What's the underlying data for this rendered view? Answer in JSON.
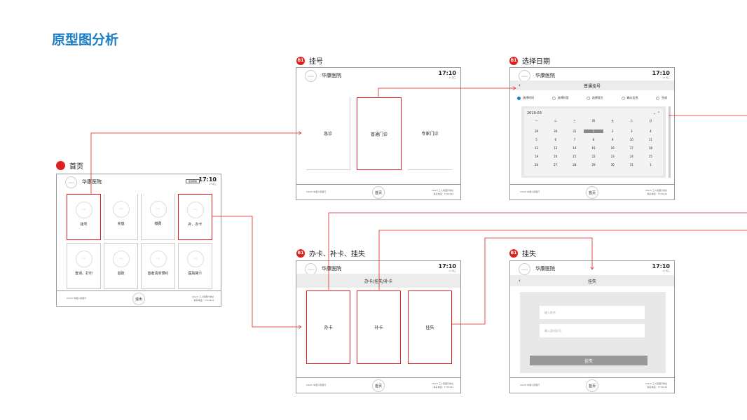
{
  "title": "原型图分析",
  "screens": {
    "home": {
      "label": "首页",
      "hospital": "华康医院",
      "time": "17:10",
      "date": "17 周三",
      "logo_text": "LOGO",
      "help_btn": "使用帮助",
      "tiles": [
        "挂号",
        "充值",
        "缴费",
        "补、办卡",
        "查询、打印",
        "退款",
        "患者清单预约",
        "医院简介"
      ],
      "tile_icon": "ICON",
      "footer_left": "Interfr 中国人民银行",
      "footer_btn": "退出",
      "footer_right1": "Interfr 工人民银行地址",
      "footer_right2": "联系电话：7724444"
    },
    "guahao": {
      "badge": "B1",
      "label": "挂号",
      "hospital": "华康医院",
      "time": "17:10",
      "date": "17 周三",
      "tiles": [
        "急诊",
        "普通门诊",
        "专家门诊"
      ],
      "footer_left": "Interfr 中国人民银行",
      "footer_btn": "首页",
      "footer_right1": "Interfr 工人民银行地址",
      "footer_right2": "联系电话：7724444"
    },
    "date": {
      "badge": "B1",
      "label": "选择日期",
      "hospital": "华康医院",
      "time": "17:10",
      "date": "17 周三",
      "bar": "普通挂号",
      "back": "‹",
      "steps": [
        "选择时间",
        "选择科室",
        "选择医生",
        "确认信息",
        "完成"
      ],
      "month": "2019-03",
      "weekdays": [
        "一",
        "二",
        "三",
        "四",
        "五",
        "六",
        "日"
      ],
      "weeks": [
        [
          "29",
          "30",
          "31",
          "1",
          "2",
          "3",
          "4"
        ],
        [
          "5",
          "6",
          "7",
          "8",
          "9",
          "10",
          "11"
        ],
        [
          "12",
          "13",
          "14",
          "15",
          "16",
          "17",
          "18"
        ],
        [
          "19",
          "20",
          "21",
          "22",
          "23",
          "24",
          "25"
        ],
        [
          "26",
          "27",
          "28",
          "29",
          "30",
          "31",
          "1"
        ]
      ],
      "footer_left": "Interfr 中国人民银行",
      "footer_btn": "首页",
      "footer_right1": "Interfr 工人民银行地址",
      "footer_right2": "联系电话：7724444"
    },
    "card": {
      "badge": "B1",
      "label": "办卡、补卡、挂失",
      "hospital": "华康医院",
      "time": "17:10",
      "date": "17 周三",
      "bar": "办卡/挂失/补卡",
      "tiles": [
        "办卡",
        "补卡",
        "挂失"
      ],
      "footer_left": "Interfr 中国人民银行",
      "footer_btn": "首页",
      "footer_right1": "Interfr 工人民银行地址",
      "footer_right2": "联系电话：7724444"
    },
    "lost": {
      "badge": "B1",
      "label": "挂失",
      "hospital": "华康医院",
      "time": "17:10",
      "date": "17 周三",
      "bar": "挂失",
      "back": "‹",
      "input1": "输入姓名",
      "input2": "输入身份证号",
      "submit": "挂失",
      "footer_left": "Interfr 中国人民银行",
      "footer_btn": "首页",
      "footer_right1": "Interfr 工人民银行地址",
      "footer_right2": "联系电话：7724444"
    }
  },
  "colors": {
    "accent": "#e02020",
    "title": "#1a7cc4"
  }
}
